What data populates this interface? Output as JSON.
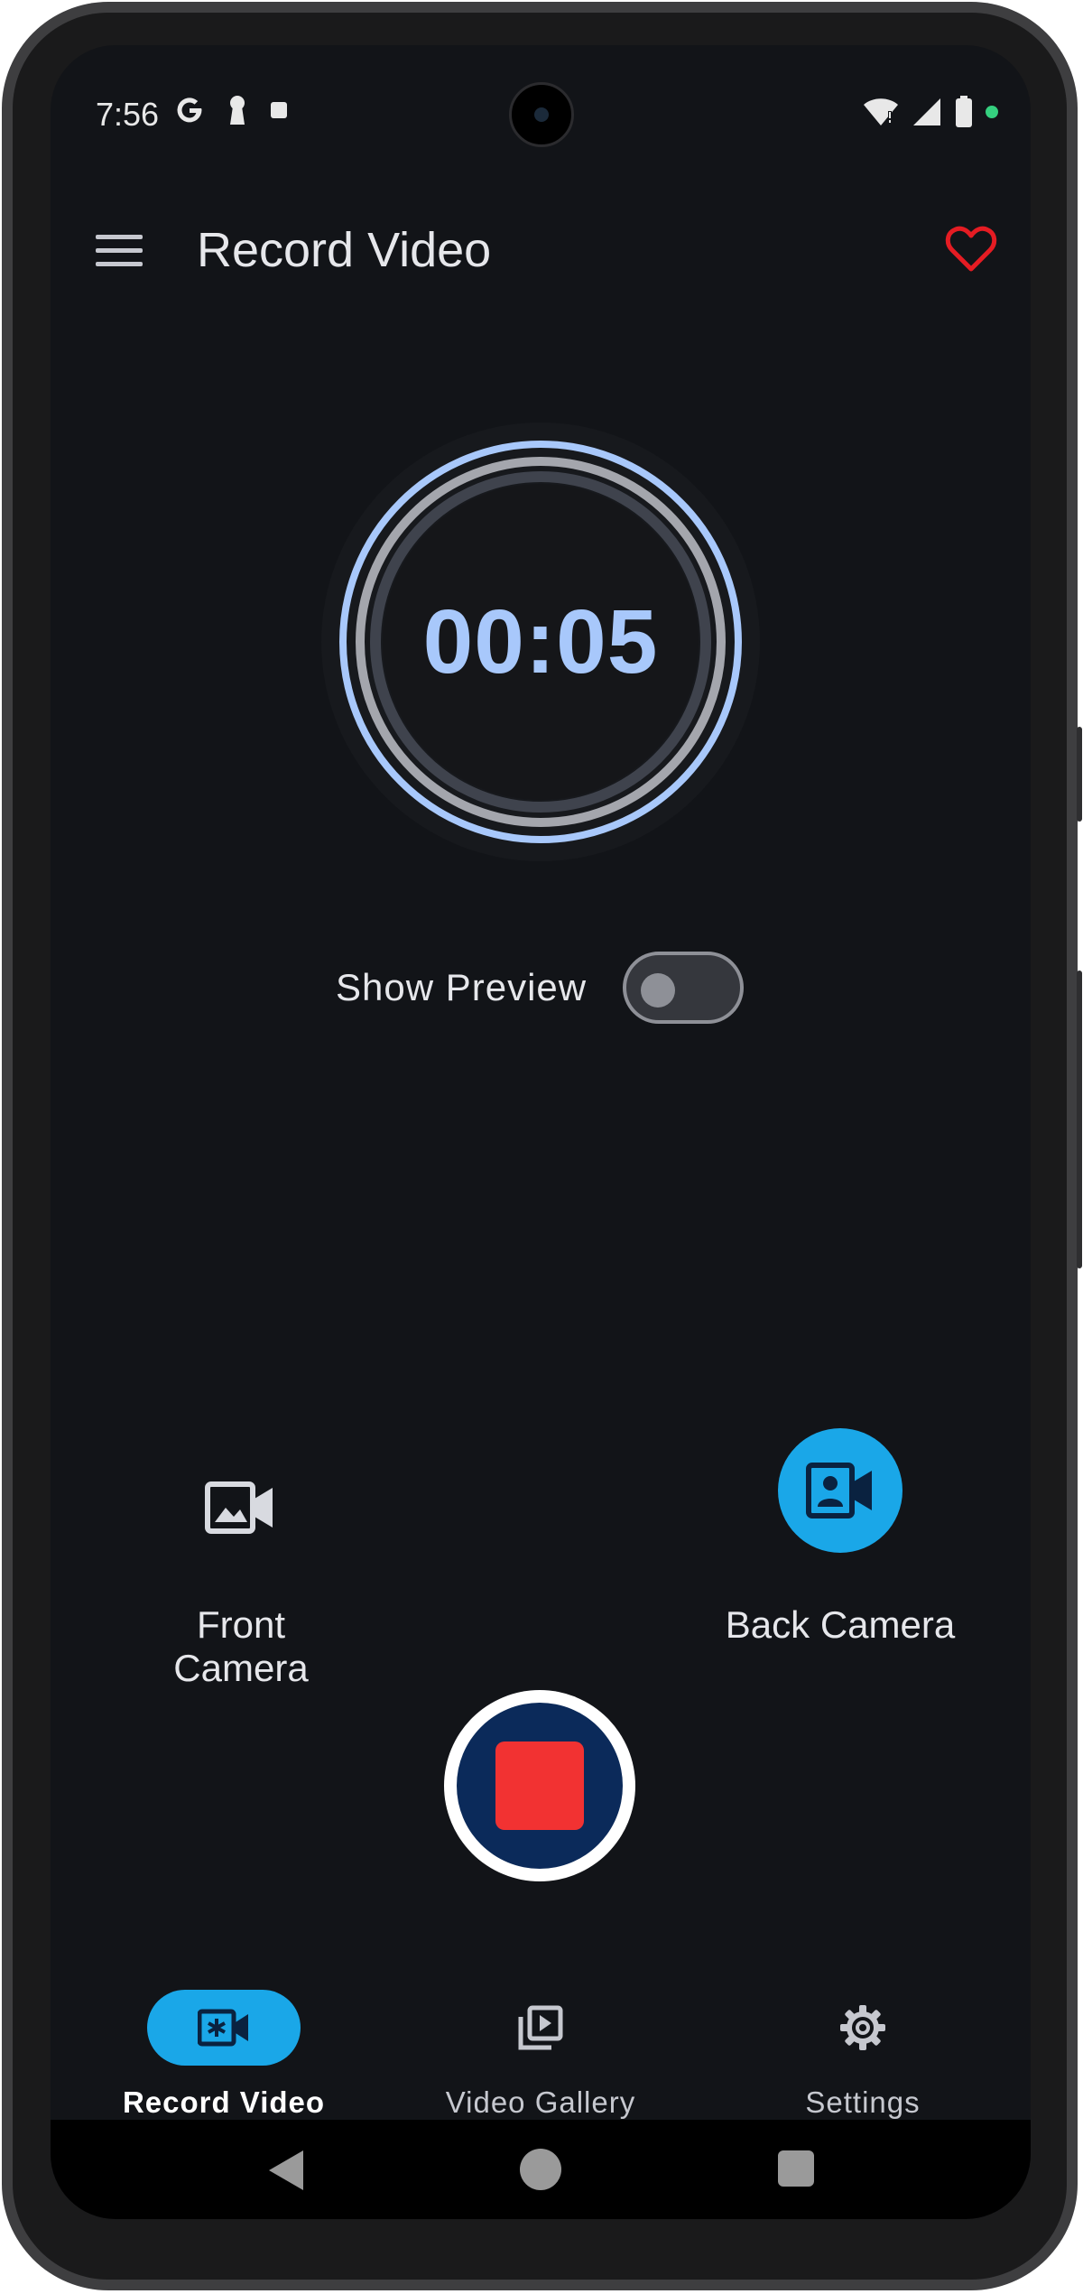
{
  "status_bar": {
    "time": "7:56",
    "left_icons": [
      "google-icon",
      "keyhole-icon",
      "square-icon"
    ],
    "right_icons": [
      "wifi-icon",
      "signal-icon",
      "battery-icon"
    ],
    "privacy_dot_color": "#35d07f"
  },
  "app_bar": {
    "title": "Record Video",
    "menu_icon": "hamburger-menu-icon",
    "favorite_icon": "heart-outline-icon",
    "favorite_color": "#e51c23"
  },
  "timer": {
    "elapsed": "00:05",
    "accent_color": "#a8c8fb"
  },
  "preview": {
    "label": "Show Preview",
    "enabled": false
  },
  "cameras": {
    "front": {
      "label": "Front Camera",
      "selected": false,
      "icon": "image-video-icon"
    },
    "back": {
      "label": "Back Camera",
      "selected": true,
      "icon": "contact-video-icon"
    },
    "selected_color": "#1aa7e8"
  },
  "record_button": {
    "state": "recording",
    "icon": "stop-icon",
    "stop_color": "#f23232",
    "ring_color": "#0b2a5a"
  },
  "bottom_nav": {
    "items": [
      {
        "label": "Record Video",
        "icon": "video-record-icon",
        "active": true
      },
      {
        "label": "Video Gallery",
        "icon": "video-library-icon",
        "active": false
      },
      {
        "label": "Settings",
        "icon": "gear-icon",
        "active": false
      }
    ]
  }
}
